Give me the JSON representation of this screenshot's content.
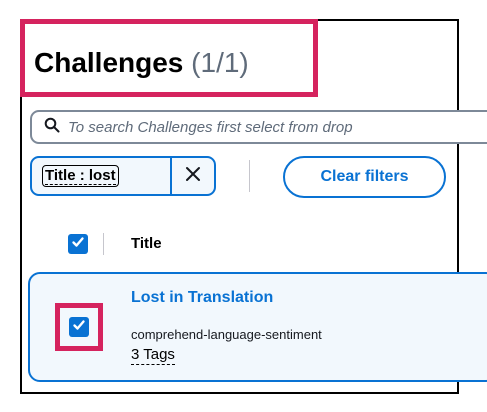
{
  "header": {
    "title": "Challenges",
    "count": "(1/1)"
  },
  "search": {
    "placeholder": "To search Challenges first select from drop"
  },
  "filters": {
    "token_label": "Title : lost",
    "clear_label": "Clear filters"
  },
  "table": {
    "columns": [
      "Title"
    ],
    "rows": [
      {
        "title": "Lost in Translation",
        "subtitle": "comprehend-language-sentiment",
        "tags": "3 Tags",
        "selected": true
      }
    ]
  },
  "colors": {
    "accent": "#0972d3",
    "highlight": "#d5235e",
    "selected_row_bg": "#f2f8fd"
  },
  "icons": [
    "search-icon",
    "close-icon",
    "checkmark-icon"
  ]
}
